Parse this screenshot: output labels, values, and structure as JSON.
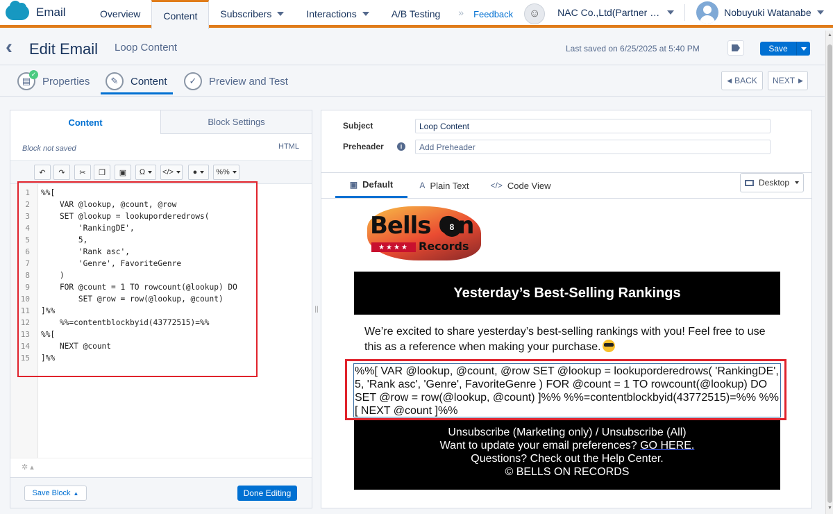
{
  "app": {
    "name": "Email"
  },
  "nav": {
    "tabs": [
      {
        "label": "Overview"
      },
      {
        "label": "Content"
      },
      {
        "label": "Subscribers"
      },
      {
        "label": "Interactions"
      },
      {
        "label": "A/B Testing"
      }
    ],
    "more_icon": "double-chevron-right-icon",
    "feedback": "Feedback",
    "org": "NAC Co.,Ltd(Partner M...",
    "user": "Nobuyuki Watanabe"
  },
  "header": {
    "title": "Edit Email",
    "email_name": "Loop Content",
    "last_saved": "Last saved on 6/25/2025 at 5:40 PM",
    "save_label": "Save"
  },
  "steps": [
    {
      "label": "Properties",
      "icon": "properties-icon"
    },
    {
      "label": "Content",
      "icon": "pencil-icon"
    },
    {
      "label": "Preview and Test",
      "icon": "check-icon"
    }
  ],
  "pager": {
    "back": "BACK",
    "next": "NEXT"
  },
  "editor": {
    "tabs": [
      {
        "label": "Content"
      },
      {
        "label": "Block Settings"
      }
    ],
    "block_status": "Block not saved",
    "mode": "HTML",
    "toolbar": {
      "omega": "Ω",
      "code": "</>",
      "person": "person-icon",
      "percent": "%%"
    },
    "lines": [
      {
        "n": "1",
        "text": "%%["
      },
      {
        "n": "2",
        "text": "    VAR @lookup, @count, @row"
      },
      {
        "n": "3",
        "text": "    SET @lookup = lookuporderedrows("
      },
      {
        "n": "4",
        "text": "        'RankingDE',"
      },
      {
        "n": "5",
        "text": "        5,"
      },
      {
        "n": "6",
        "text": "        'Rank asc',"
      },
      {
        "n": "7",
        "text": "        'Genre', FavoriteGenre"
      },
      {
        "n": "8",
        "text": "    )"
      },
      {
        "n": "9",
        "text": "    FOR @count = 1 TO rowcount(@lookup) DO"
      },
      {
        "n": "10",
        "text": "        SET @row = row(@lookup, @count)"
      },
      {
        "n": "11",
        "text": "]%%"
      },
      {
        "n": "12",
        "text": "    %%=contentblockbyid(43772515)=%%"
      },
      {
        "n": "13",
        "text": "%%["
      },
      {
        "n": "14",
        "text": "    NEXT @count"
      },
      {
        "n": "15",
        "text": "]%%"
      }
    ],
    "save_block": "Save Block",
    "done": "Done Editing"
  },
  "preview": {
    "subject_label": "Subject",
    "subject": "Loop Content",
    "preheader_label": "Preheader",
    "preheader_placeholder": "Add Preheader",
    "tabs": [
      {
        "label": "Default"
      },
      {
        "label": "Plain Text"
      },
      {
        "label": "Code View"
      }
    ],
    "device": "Desktop",
    "logo_text": {
      "main": "Bells On",
      "ball": "8",
      "sub": "Records"
    },
    "banner": "Yesterday’s Best-Selling Rankings",
    "intro": "We’re excited to share yesterday’s best-selling rankings with you! Feel free to use this as a reference when making your purchase.",
    "rendered_code": "%%[ VAR @lookup, @count, @row SET @lookup = lookuporderedrows( 'RankingDE', 5, 'Rank asc', 'Genre', FavoriteGenre ) FOR @count = 1 TO rowcount(@lookup) DO SET @row = row(@lookup, @count) ]%% %%=contentblockbyid(43772515)=%% %%[ NEXT @count ]%%",
    "footer": {
      "line1": "Unsubscribe (Marketing only) / Unsubscribe (All)",
      "line2_prefix": "Want to update your email preferences? ",
      "line2_link": "GO HERE.",
      "line3": "Questions? Check out the Help Center.",
      "line4": "© BELLS ON RECORDS"
    }
  },
  "colors": {
    "brand_orange": "#e07c1a",
    "primary_blue": "#0070d2",
    "highlight_red": "#e0232c"
  }
}
